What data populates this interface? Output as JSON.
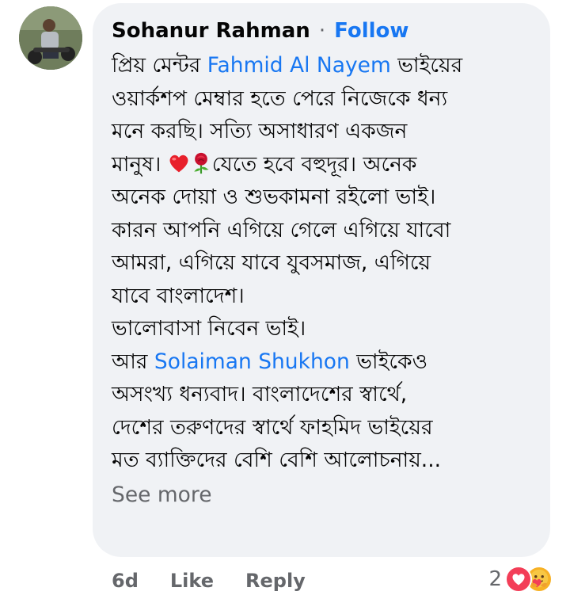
{
  "comment": {
    "author": "Sohanur Rahman",
    "separator": "·",
    "follow_label": "Follow",
    "lines": [
      {
        "before": "প্রিয় মেন্টর ",
        "mention": "Fahmid Al Nayem",
        "after": " ভাইয়ের"
      },
      {
        "text": "ওয়ার্কশপ মেম্বার হতে পেরে নিজেকে ধন্য"
      },
      {
        "text": "মনে করছি। সত্যি অসাধারণ একজন"
      },
      {
        "before": "মানুষ। ",
        "emojis": [
          "heart",
          "rose"
        ],
        "after": "যেতে হবে বহুদূর। অনেক"
      },
      {
        "text": "অনেক দোয়া ও শুভকামনা রইলো ভাই।"
      },
      {
        "text": "কারন আপনি এগিয়ে গেলে এগিয়ে যাবো"
      },
      {
        "text": "আমরা, এগিয়ে যাবে যুবসমাজ, এগিয়ে"
      },
      {
        "text": "যাবে বাংলাদেশ।"
      },
      {
        "text": "ভালোবাসা নিবেন ভাই।"
      },
      {
        "before": "আর ",
        "mention": "Solaiman Shukhon",
        "after": " ভাইকেও"
      },
      {
        "text": "অসংখ্য ধন্যবাদ। বাংলাদেশের স্বার্থে,"
      },
      {
        "text": "দেশের তরুণদের স্বার্থে ফাহমিদ ভাইয়ের"
      },
      {
        "text": "মত ব্যাক্তিদের বেশি বেশি আলোচনায়..."
      }
    ],
    "see_more_label": "See more",
    "time": "6d",
    "like_label": "Like",
    "reply_label": "Reply",
    "reaction_count": "2",
    "reaction_icons": [
      "love-icon",
      "care-icon"
    ]
  },
  "colors": {
    "bubble_bg": "#f0f2f5",
    "link_blue": "#1877f2",
    "meta_gray": "#65676b",
    "text": "#050505"
  }
}
